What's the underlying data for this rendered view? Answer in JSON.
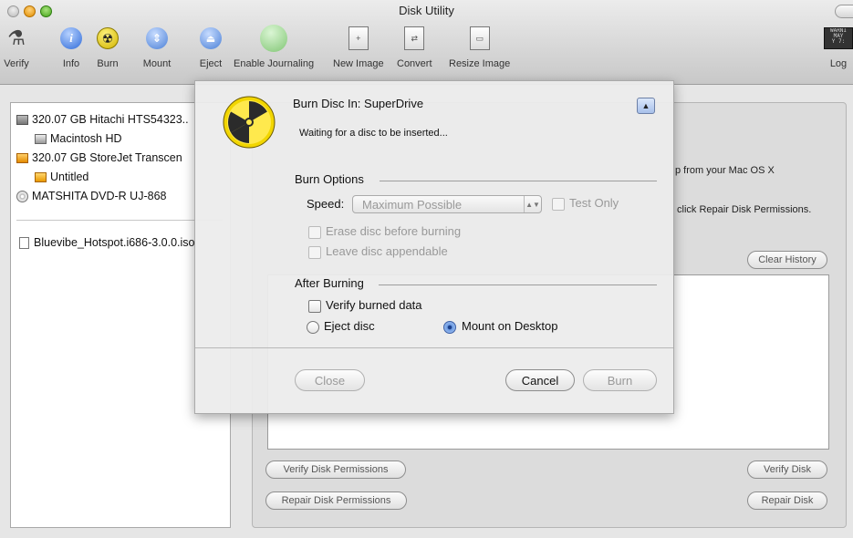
{
  "window": {
    "title": "Disk Utility"
  },
  "toolbar": {
    "verify": "Verify",
    "info": "Info",
    "burn": "Burn",
    "mount": "Mount",
    "eject": "Eject",
    "enable_journaling": "Enable Journaling",
    "new_image": "New Image",
    "convert": "Convert",
    "resize_image": "Resize Image",
    "log": "Log"
  },
  "sidebar": {
    "items": [
      {
        "label": "320.07 GB Hitachi HTS54323..",
        "icon": "hard-disk-icon"
      },
      {
        "label": "Macintosh HD",
        "icon": "volume-icon"
      },
      {
        "label": "320.07 GB StoreJet Transcen",
        "icon": "external-disk-icon"
      },
      {
        "label": "Untitled",
        "icon": "external-volume-icon"
      },
      {
        "label": "MATSHITA DVD-R UJ-868",
        "icon": "optical-drive-icon"
      },
      {
        "label": "Bluevibe_Hotspot.i686-3.0.0.iso",
        "icon": "disk-image-icon"
      }
    ]
  },
  "main": {
    "hint_right_1": "p from your Mac OS X",
    "hint_right_2": "click Repair Disk Permissions.",
    "clear_history": "Clear History",
    "verify_permissions": "Verify Disk Permissions",
    "repair_permissions": "Repair Disk Permissions",
    "verify_disk": "Verify Disk",
    "repair_disk": "Repair Disk"
  },
  "sheet": {
    "title": "Burn Disc In:  SuperDrive",
    "status": "Waiting for a disc to be inserted...",
    "burn_options_label": "Burn Options",
    "speed_label": "Speed:",
    "speed_value": "Maximum Possible",
    "test_only": "Test Only",
    "erase_before": "Erase disc before burning",
    "leave_appendable": "Leave disc appendable",
    "after_burning_label": "After Burning",
    "verify_burned": "Verify burned data",
    "eject_disc": "Eject disc",
    "mount_on_desktop": "Mount on Desktop",
    "close": "Close",
    "cancel": "Cancel",
    "burn": "Burn"
  }
}
